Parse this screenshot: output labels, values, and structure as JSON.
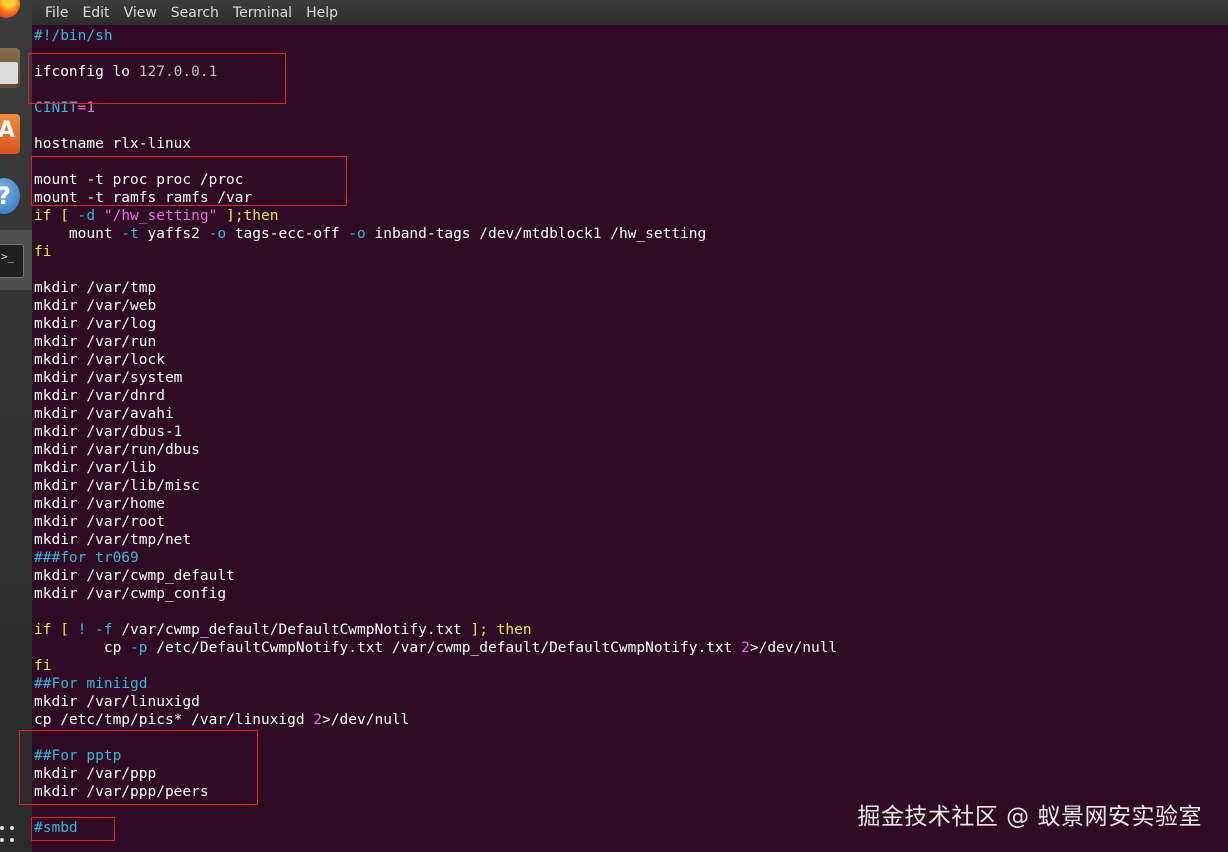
{
  "menubar": {
    "items": [
      "File",
      "Edit",
      "View",
      "Search",
      "Terminal",
      "Help"
    ]
  },
  "terminal": {
    "lines": [
      {
        "segs": [
          {
            "t": "#!/bin/sh",
            "c": "cm"
          }
        ]
      },
      {
        "segs": []
      },
      {
        "segs": [
          {
            "t": "ifconfig lo ",
            "c": ""
          },
          {
            "t": "127.0.0.1",
            "c": "gray"
          }
        ]
      },
      {
        "segs": []
      },
      {
        "segs": [
          {
            "t": "CINIT",
            "c": "cm"
          },
          {
            "t": "=1",
            "c": "nm"
          }
        ]
      },
      {
        "segs": []
      },
      {
        "segs": [
          {
            "t": "hostname rlx-linux",
            "c": ""
          }
        ]
      },
      {
        "segs": []
      },
      {
        "segs": [
          {
            "t": "mount -t proc proc /proc",
            "c": ""
          }
        ]
      },
      {
        "segs": [
          {
            "t": "mount -t ramfs ramfs /var",
            "c": ""
          }
        ]
      },
      {
        "segs": [
          {
            "t": "if",
            "c": "kw"
          },
          {
            "t": " [ ",
            "c": "kw"
          },
          {
            "t": "-d",
            "c": "fl"
          },
          {
            "t": " \"/hw_setting\"",
            "c": "st"
          },
          {
            "t": " ];then",
            "c": "kw"
          }
        ]
      },
      {
        "segs": [
          {
            "t": "    mount ",
            "c": ""
          },
          {
            "t": "-t",
            "c": "fl"
          },
          {
            "t": " yaffs2 ",
            "c": ""
          },
          {
            "t": "-o",
            "c": "fl"
          },
          {
            "t": " tags-ecc-off ",
            "c": ""
          },
          {
            "t": "-o",
            "c": "fl"
          },
          {
            "t": " inband-tags /dev/mtdblock1 /hw_setting",
            "c": ""
          }
        ]
      },
      {
        "segs": [
          {
            "t": "fi",
            "c": "kw"
          }
        ]
      },
      {
        "segs": []
      },
      {
        "segs": [
          {
            "t": "mkdir /var/tmp",
            "c": ""
          }
        ]
      },
      {
        "segs": [
          {
            "t": "mkdir /var/web",
            "c": ""
          }
        ]
      },
      {
        "segs": [
          {
            "t": "mkdir /var/log",
            "c": ""
          }
        ]
      },
      {
        "segs": [
          {
            "t": "mkdir /var/run",
            "c": ""
          }
        ]
      },
      {
        "segs": [
          {
            "t": "mkdir /var/lock",
            "c": ""
          }
        ]
      },
      {
        "segs": [
          {
            "t": "mkdir /var/system",
            "c": ""
          }
        ]
      },
      {
        "segs": [
          {
            "t": "mkdir /var/dnrd",
            "c": ""
          }
        ]
      },
      {
        "segs": [
          {
            "t": "mkdir /var/avahi",
            "c": ""
          }
        ]
      },
      {
        "segs": [
          {
            "t": "mkdir /var/dbus-1",
            "c": ""
          }
        ]
      },
      {
        "segs": [
          {
            "t": "mkdir /var/run/dbus",
            "c": ""
          }
        ]
      },
      {
        "segs": [
          {
            "t": "mkdir /var/lib",
            "c": ""
          }
        ]
      },
      {
        "segs": [
          {
            "t": "mkdir /var/lib/misc",
            "c": ""
          }
        ]
      },
      {
        "segs": [
          {
            "t": "mkdir /var/home",
            "c": ""
          }
        ]
      },
      {
        "segs": [
          {
            "t": "mkdir /var/root",
            "c": ""
          }
        ]
      },
      {
        "segs": [
          {
            "t": "mkdir /var/tmp/net",
            "c": ""
          }
        ]
      },
      {
        "segs": [
          {
            "t": "###for tr069",
            "c": "cm"
          }
        ]
      },
      {
        "segs": [
          {
            "t": "mkdir /var/cwmp_default",
            "c": ""
          }
        ]
      },
      {
        "segs": [
          {
            "t": "mkdir /var/cwmp_config",
            "c": ""
          }
        ]
      },
      {
        "segs": []
      },
      {
        "segs": [
          {
            "t": "if",
            "c": "kw"
          },
          {
            "t": " [ ",
            "c": "kw"
          },
          {
            "t": "! -f",
            "c": "fl"
          },
          {
            "t": " /var/cwmp_default/DefaultCwmpNotify.txt ",
            "c": ""
          },
          {
            "t": "]; then",
            "c": "kw"
          }
        ]
      },
      {
        "segs": [
          {
            "t": "        cp ",
            "c": ""
          },
          {
            "t": "-p",
            "c": "fl"
          },
          {
            "t": " /etc/DefaultCwmpNotify.txt /var/cwmp_default/DefaultCwmpNotify.txt ",
            "c": ""
          },
          {
            "t": "2",
            "c": "nm"
          },
          {
            "t": ">/dev/null",
            "c": ""
          }
        ]
      },
      {
        "segs": [
          {
            "t": "fi",
            "c": "kw"
          }
        ]
      },
      {
        "segs": [
          {
            "t": "##For miniigd",
            "c": "cm"
          }
        ]
      },
      {
        "segs": [
          {
            "t": "mkdir /var/linuxigd",
            "c": ""
          }
        ]
      },
      {
        "segs": [
          {
            "t": "cp /etc/tmp/pics* /var/linuxigd ",
            "c": ""
          },
          {
            "t": "2",
            "c": "nm"
          },
          {
            "t": ">/dev/null",
            "c": ""
          }
        ]
      },
      {
        "segs": []
      },
      {
        "segs": [
          {
            "t": "##For pptp",
            "c": "cm"
          }
        ]
      },
      {
        "segs": [
          {
            "t": "mkdir /var/ppp",
            "c": ""
          }
        ]
      },
      {
        "segs": [
          {
            "t": "mkdir /var/ppp/peers",
            "c": ""
          }
        ]
      },
      {
        "segs": []
      },
      {
        "segs": [
          {
            "t": "#smbd",
            "c": "cm"
          }
        ]
      }
    ]
  },
  "watermark": "掘金技术社区 @ 蚁景网安实验室",
  "dock": {
    "icons": [
      "firefox-icon",
      "files-icon",
      "software-center-icon",
      "help-icon",
      "terminal-icon",
      "show-apps-icon"
    ],
    "store_glyph": "A",
    "help_glyph": "?",
    "term_glyph": ">_"
  }
}
